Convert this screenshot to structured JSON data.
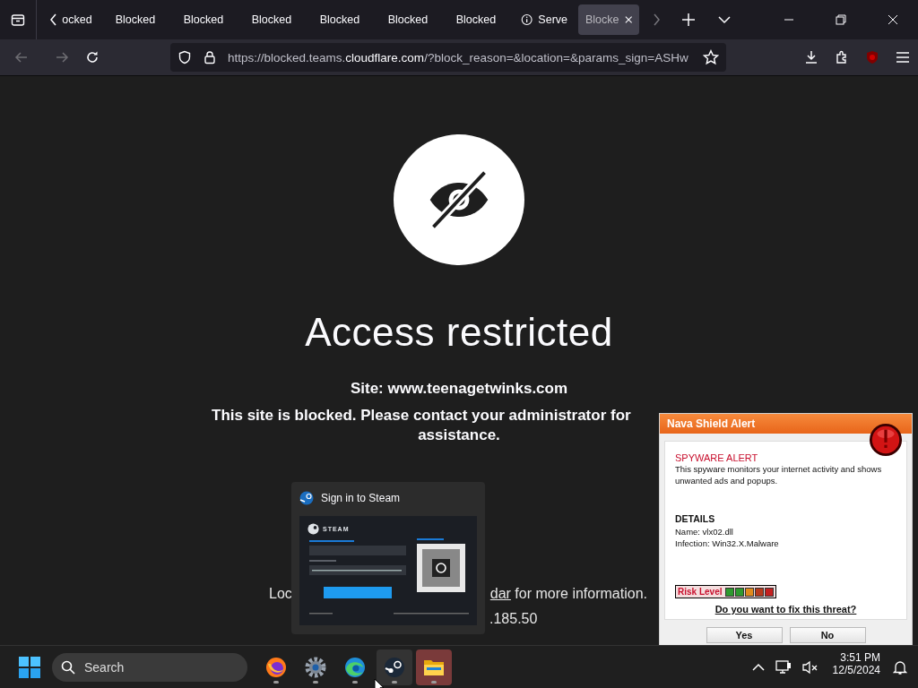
{
  "browser": {
    "tabs": [
      {
        "label": "ocked",
        "kind": "page",
        "selected": false
      },
      {
        "label": "Blocked",
        "kind": "page",
        "selected": false
      },
      {
        "label": "Blocked",
        "kind": "page",
        "selected": false
      },
      {
        "label": "Blocked",
        "kind": "page",
        "selected": false
      },
      {
        "label": "Blocked",
        "kind": "page",
        "selected": false
      },
      {
        "label": "Blocked",
        "kind": "page",
        "selected": false
      },
      {
        "label": "Blocked",
        "kind": "page",
        "selected": false
      },
      {
        "label": "Serve",
        "kind": "info",
        "selected": false
      },
      {
        "label": "Blocke",
        "kind": "page",
        "selected": true
      }
    ],
    "address": {
      "before": "https://blocked.teams.",
      "domain": "cloudflare.com",
      "after": "/?block_reason=&location=&params_sign=ASHw"
    }
  },
  "page": {
    "heading": "Access restricted",
    "site": "Site: www.teenagetwinks.com",
    "message_lines": [
      "This site is blocked. Please contact your administrator for",
      "assistance."
    ],
    "info_start": "Loc",
    "info_link": "dar",
    "info_end": "for more information.",
    "ip_fragment": ".185.50"
  },
  "steam_preview": {
    "title": "Sign in to Steam",
    "logo_text": "STEAM"
  },
  "alert": {
    "title": "Nava Shield Alert",
    "heading": "SPYWARE ALERT",
    "body": "This spyware monitors your internet activity and shows unwanted ads and popups.",
    "details_title": "DETAILS",
    "details": [
      "Name: vlx02.dll",
      "Infection: Win32.X.Malware"
    ],
    "risk_label": "Risk Level",
    "risk_segments": [
      {
        "color": "#2f9a2f"
      },
      {
        "color": "#2f9a2f"
      },
      {
        "color": "#e08a1c"
      },
      {
        "color": "#b83a1c"
      },
      {
        "color": "#c42020"
      }
    ],
    "question": "Do you want to fix this threat?",
    "buttons": [
      "Yes",
      "No"
    ]
  },
  "taskbar": {
    "search": {
      "placeholder": "Search"
    },
    "apps": [
      {
        "kind": "firefox",
        "selected": false,
        "hovered": false
      },
      {
        "kind": "settings",
        "selected": false,
        "hovered": false
      },
      {
        "kind": "edge",
        "selected": false,
        "hovered": false
      },
      {
        "kind": "steam",
        "selected": false,
        "hovered": true
      },
      {
        "kind": "explorer",
        "selected": true,
        "hovered": false
      }
    ],
    "time": "3:51 PM",
    "date": "12/5/2024"
  }
}
